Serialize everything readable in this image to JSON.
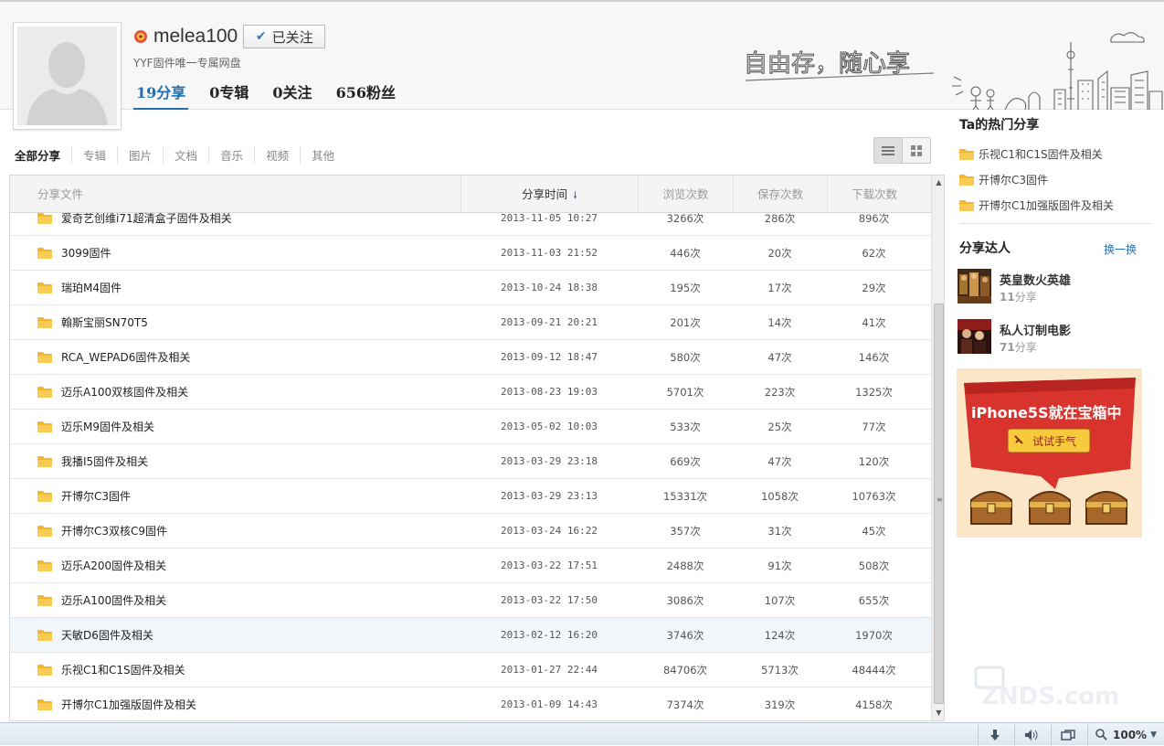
{
  "header": {
    "username": "melea100",
    "follow_label": "已关注",
    "bio": "YYF固件唯一专属网盘",
    "stats": [
      {
        "label": "19分享"
      },
      {
        "label": "0专辑"
      },
      {
        "label": "0关注"
      },
      {
        "label": "656粉丝"
      }
    ],
    "slogan": "自由存，随心享"
  },
  "filters": [
    "全部分享",
    "专辑",
    "图片",
    "文档",
    "音乐",
    "视频",
    "其他"
  ],
  "table": {
    "headers": {
      "name": "分享文件",
      "time": "分享时间",
      "views": "浏览次数",
      "saves": "保存次数",
      "downloads": "下载次数"
    },
    "rows": [
      {
        "name": "爱奇艺创维i71超清盒子固件及相关",
        "time": "2013-11-05 10:27",
        "views": "3266次",
        "saves": "286次",
        "downloads": "896次"
      },
      {
        "name": "3099固件",
        "time": "2013-11-03 21:52",
        "views": "446次",
        "saves": "20次",
        "downloads": "62次"
      },
      {
        "name": "瑞珀M4固件",
        "time": "2013-10-24 18:38",
        "views": "195次",
        "saves": "17次",
        "downloads": "29次"
      },
      {
        "name": "翰斯宝丽SN70T5",
        "time": "2013-09-21 20:21",
        "views": "201次",
        "saves": "14次",
        "downloads": "41次"
      },
      {
        "name": "RCA_WEPAD6固件及相关",
        "time": "2013-09-12 18:47",
        "views": "580次",
        "saves": "47次",
        "downloads": "146次"
      },
      {
        "name": "迈乐A100双核固件及相关",
        "time": "2013-08-23 19:03",
        "views": "5701次",
        "saves": "223次",
        "downloads": "1325次"
      },
      {
        "name": "迈乐M9固件及相关",
        "time": "2013-05-02 10:03",
        "views": "533次",
        "saves": "25次",
        "downloads": "77次"
      },
      {
        "name": "我播I5固件及相关",
        "time": "2013-03-29 23:18",
        "views": "669次",
        "saves": "47次",
        "downloads": "120次"
      },
      {
        "name": "开博尔C3固件",
        "time": "2013-03-29 23:13",
        "views": "15331次",
        "saves": "1058次",
        "downloads": "10763次"
      },
      {
        "name": "开博尔C3双核C9固件",
        "time": "2013-03-24 16:22",
        "views": "357次",
        "saves": "31次",
        "downloads": "45次"
      },
      {
        "name": "迈乐A200固件及相关",
        "time": "2013-03-22 17:51",
        "views": "2488次",
        "saves": "91次",
        "downloads": "508次"
      },
      {
        "name": "迈乐A100固件及相关",
        "time": "2013-03-22 17:50",
        "views": "3086次",
        "saves": "107次",
        "downloads": "655次"
      },
      {
        "name": "天敏D6固件及相关",
        "time": "2013-02-12 16:20",
        "views": "3746次",
        "saves": "124次",
        "downloads": "1970次"
      },
      {
        "name": "乐视C1和C1S固件及相关",
        "time": "2013-01-27 22:44",
        "views": "84706次",
        "saves": "5713次",
        "downloads": "48444次"
      },
      {
        "name": "开博尔C1加强版固件及相关",
        "time": "2013-01-09 14:43",
        "views": "7374次",
        "saves": "319次",
        "downloads": "4158次"
      }
    ]
  },
  "sidebar": {
    "hot_title": "Ta的热门分享",
    "hot_items": [
      "乐视C1和C1S固件及相关",
      "开博尔C3固件",
      "开博尔C1加强版固件及相关"
    ],
    "talent_title": "分享达人",
    "switch_label": "换一换",
    "talents": [
      {
        "name": "英皇数火英雄",
        "count": "11",
        "unit": "分享"
      },
      {
        "name": "私人订制电影",
        "count": "71",
        "unit": "分享"
      }
    ],
    "ad": {
      "headline": "iPhone5S就在宝箱中",
      "button": "试试手气"
    }
  },
  "statusbar": {
    "zoom": "100%"
  },
  "watermark": "ZNDS.com",
  "colors": {
    "accent": "#1f6fb2",
    "folder": "#f5c342",
    "hover_row": "#f2f7fc"
  }
}
